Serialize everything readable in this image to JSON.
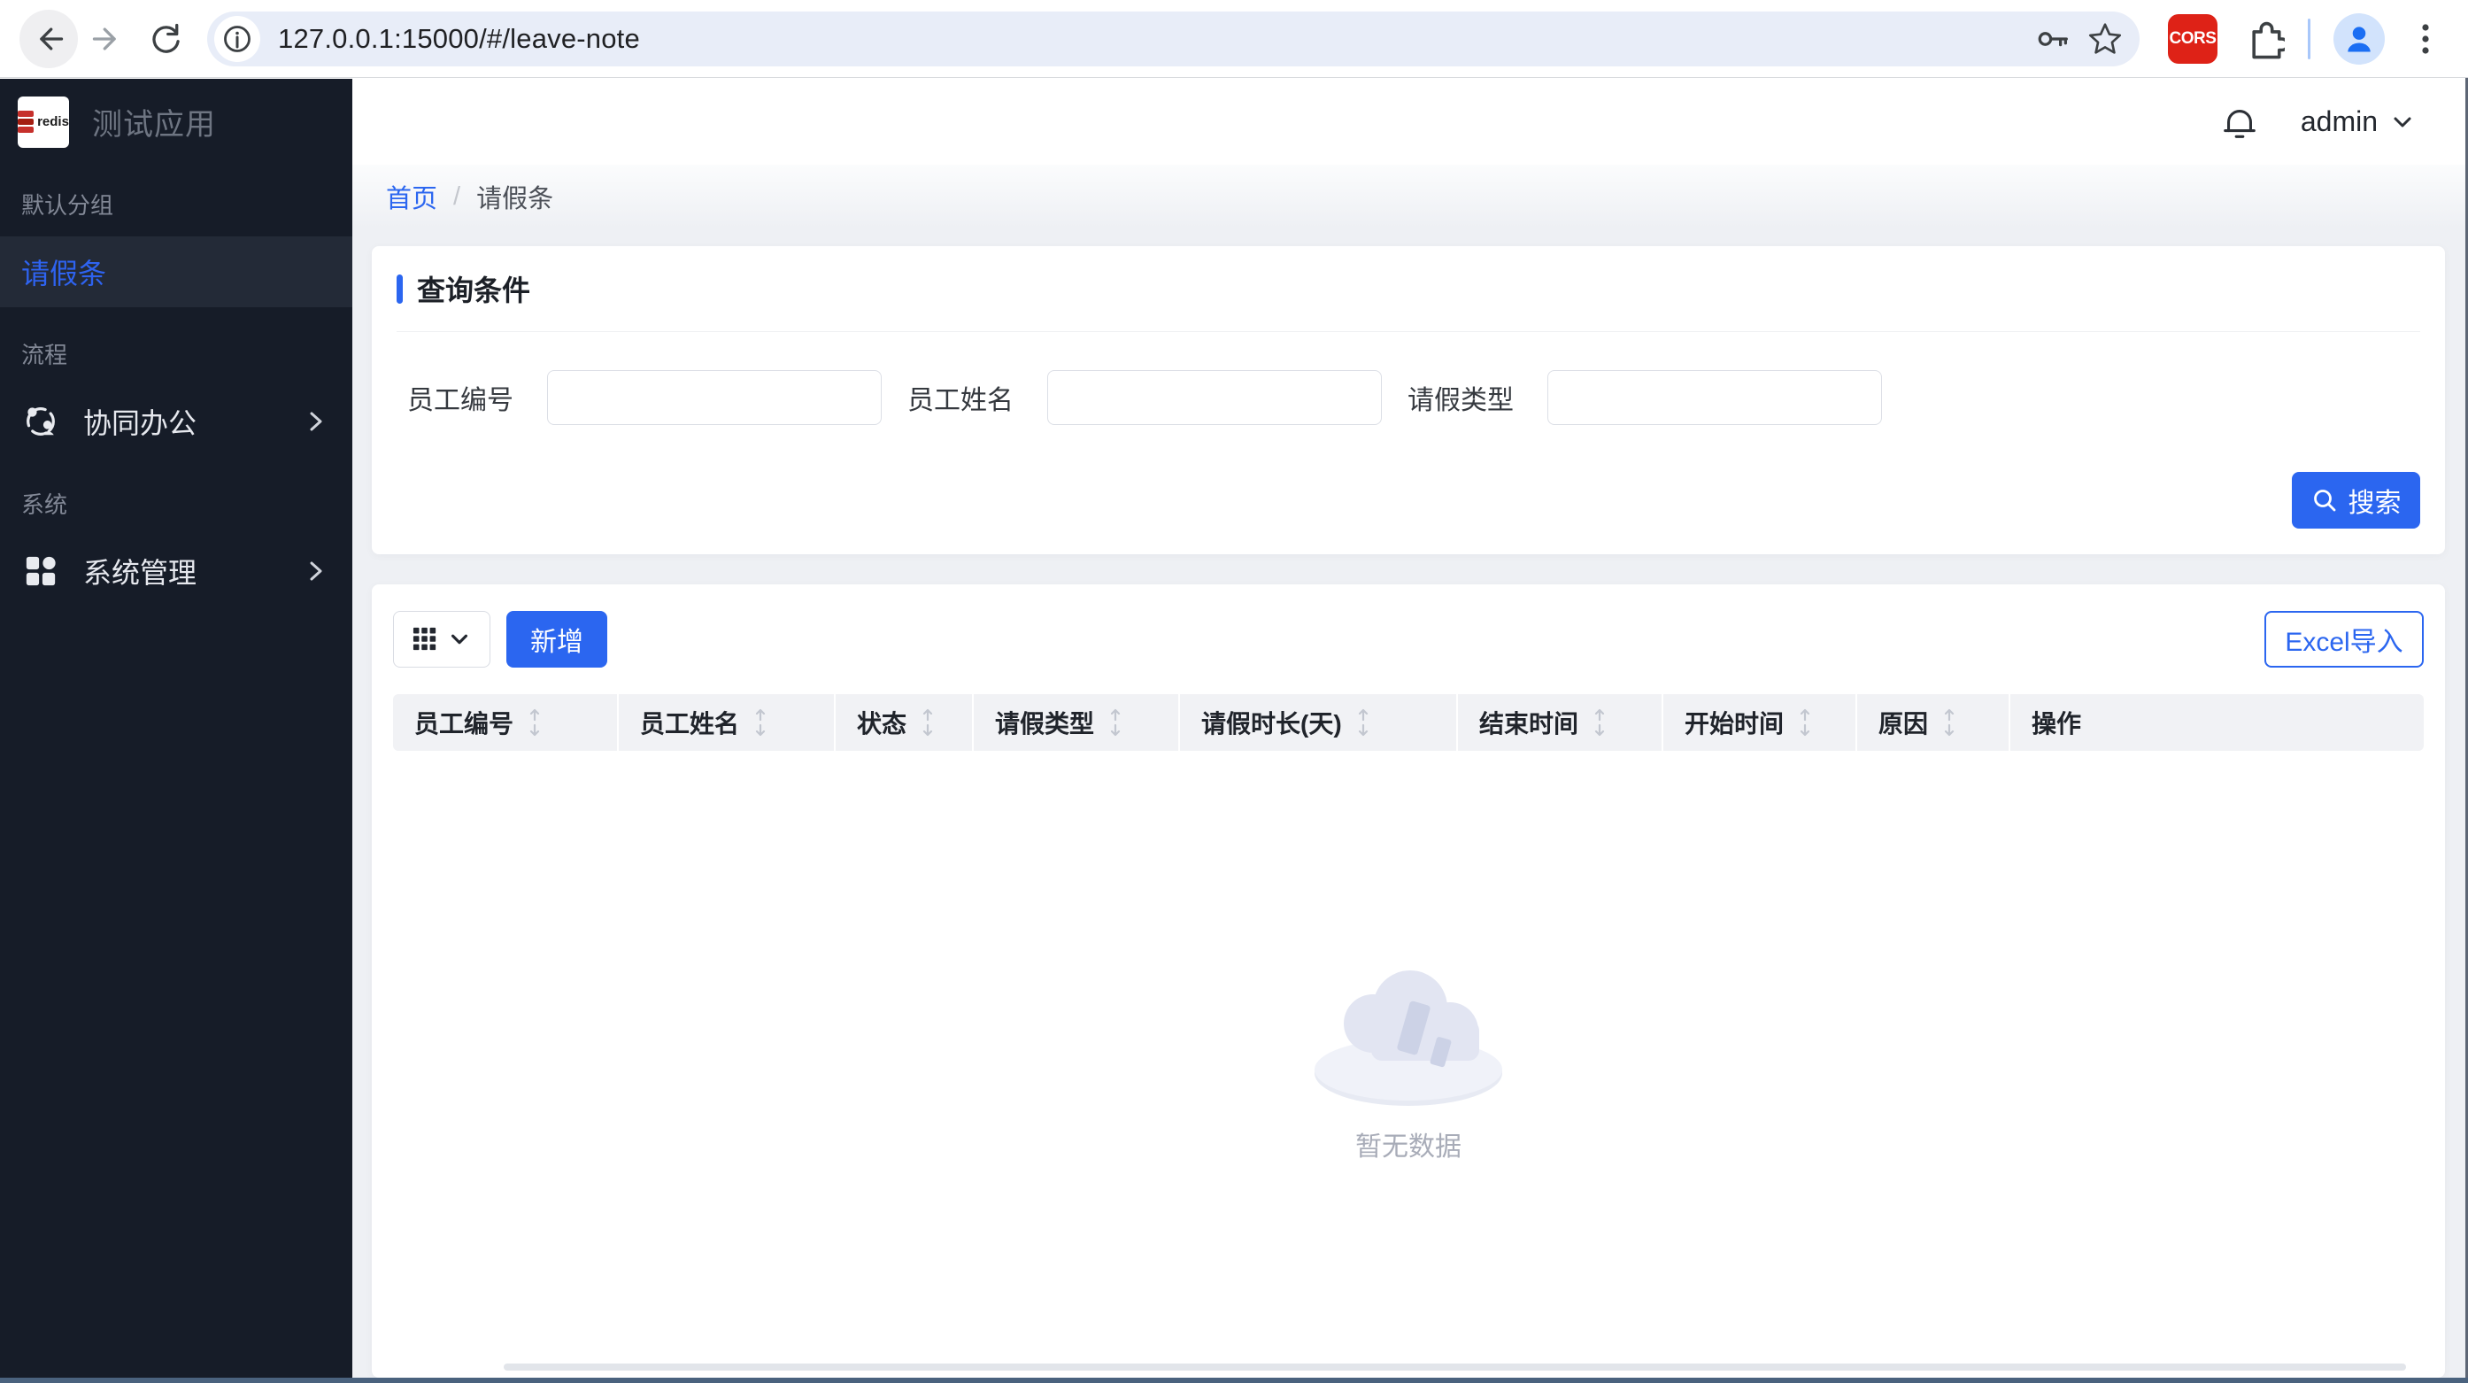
{
  "browser": {
    "url": "127.0.0.1:15000/#/leave-note",
    "cors_badge": "CORS"
  },
  "app": {
    "logo_label": "redis",
    "title": "测试应用",
    "user": "admin"
  },
  "sidebar": {
    "groups": [
      {
        "label": "默认分组",
        "items": [
          {
            "label": "请假条",
            "active": true
          }
        ]
      },
      {
        "label": "流程",
        "items": [
          {
            "label": "协同办公",
            "icon": "team-icon",
            "expandable": true
          }
        ]
      },
      {
        "label": "系统",
        "items": [
          {
            "label": "系统管理",
            "icon": "apps-grid-icon",
            "expandable": true
          }
        ]
      }
    ]
  },
  "breadcrumb": {
    "home": "首页",
    "separator": "/",
    "current": "请假条"
  },
  "query": {
    "title": "查询条件",
    "fields": [
      {
        "label": "员工编号",
        "value": ""
      },
      {
        "label": "员工姓名",
        "value": ""
      },
      {
        "label": "请假类型",
        "value": ""
      }
    ],
    "search_label": "搜索"
  },
  "table": {
    "add_label": "新增",
    "excel_label": "Excel导入",
    "columns": [
      "员工编号",
      "员工姓名",
      "状态",
      "请假类型",
      "请假时长(天)",
      "结束时间",
      "开始时间",
      "原因",
      "操作"
    ],
    "rows": [],
    "empty_text": "暂无数据"
  },
  "colors": {
    "accent": "#2b66f0",
    "sidebar_bg": "#161c28",
    "sidebar_active_bg": "#232a37",
    "content_bg": "#eef0f4",
    "cors_red": "#de2217",
    "omnibox_bg": "#e8edf8"
  }
}
